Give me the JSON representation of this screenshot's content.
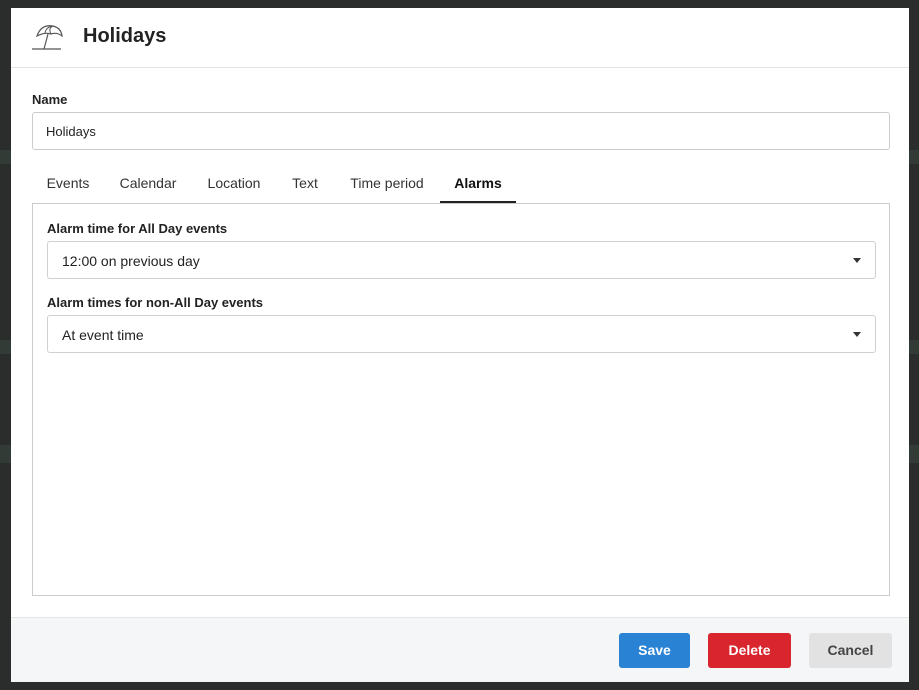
{
  "dialog": {
    "title": "Holidays",
    "icon": "beach-umbrella-icon"
  },
  "name_field": {
    "label": "Name",
    "value": "Holidays"
  },
  "tabs": [
    {
      "label": "Events",
      "active": false
    },
    {
      "label": "Calendar",
      "active": false
    },
    {
      "label": "Location",
      "active": false
    },
    {
      "label": "Text",
      "active": false
    },
    {
      "label": "Time period",
      "active": false
    },
    {
      "label": "Alarms",
      "active": true
    }
  ],
  "alarms": {
    "all_day_label": "Alarm time for All Day events",
    "all_day_value": "12:00 on previous day",
    "non_all_day_label": "Alarm times for non-All Day events",
    "non_all_day_value": "At event time"
  },
  "footer": {
    "save_label": "Save",
    "delete_label": "Delete",
    "cancel_label": "Cancel"
  },
  "colors": {
    "save": "#2a82d4",
    "delete": "#d9262e",
    "cancel": "#e2e2e2"
  }
}
